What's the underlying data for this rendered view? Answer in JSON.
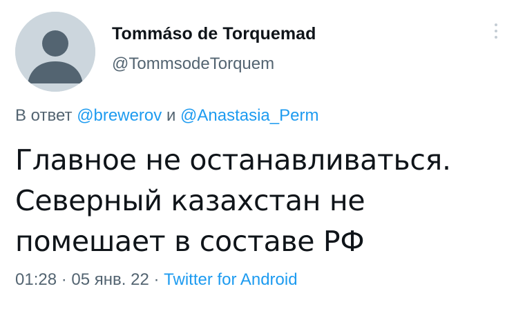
{
  "author": {
    "display_name": "Tommáso de Torquemad",
    "handle": "@TommsodeTorquem"
  },
  "reply": {
    "prefix": "В ответ",
    "user1": "@brewerov",
    "conjunction": "и",
    "user2": "@Anastasia_Perm"
  },
  "tweet": {
    "lines": [
      "Главное не останавливаться.",
      "Северный казахстан не",
      "помешает в составе РФ"
    ]
  },
  "meta": {
    "time": "01:28",
    "separator1": "·",
    "date": "05 янв. 22",
    "separator2": "·",
    "source": "Twitter for Android"
  },
  "icons": {
    "avatar": "default-avatar-icon",
    "more": "more-options-icon"
  },
  "colors": {
    "accent": "#1d9bf0",
    "secondary_text": "#536471",
    "avatar_bg": "#ccd6dd",
    "avatar_fg": "#536471"
  }
}
